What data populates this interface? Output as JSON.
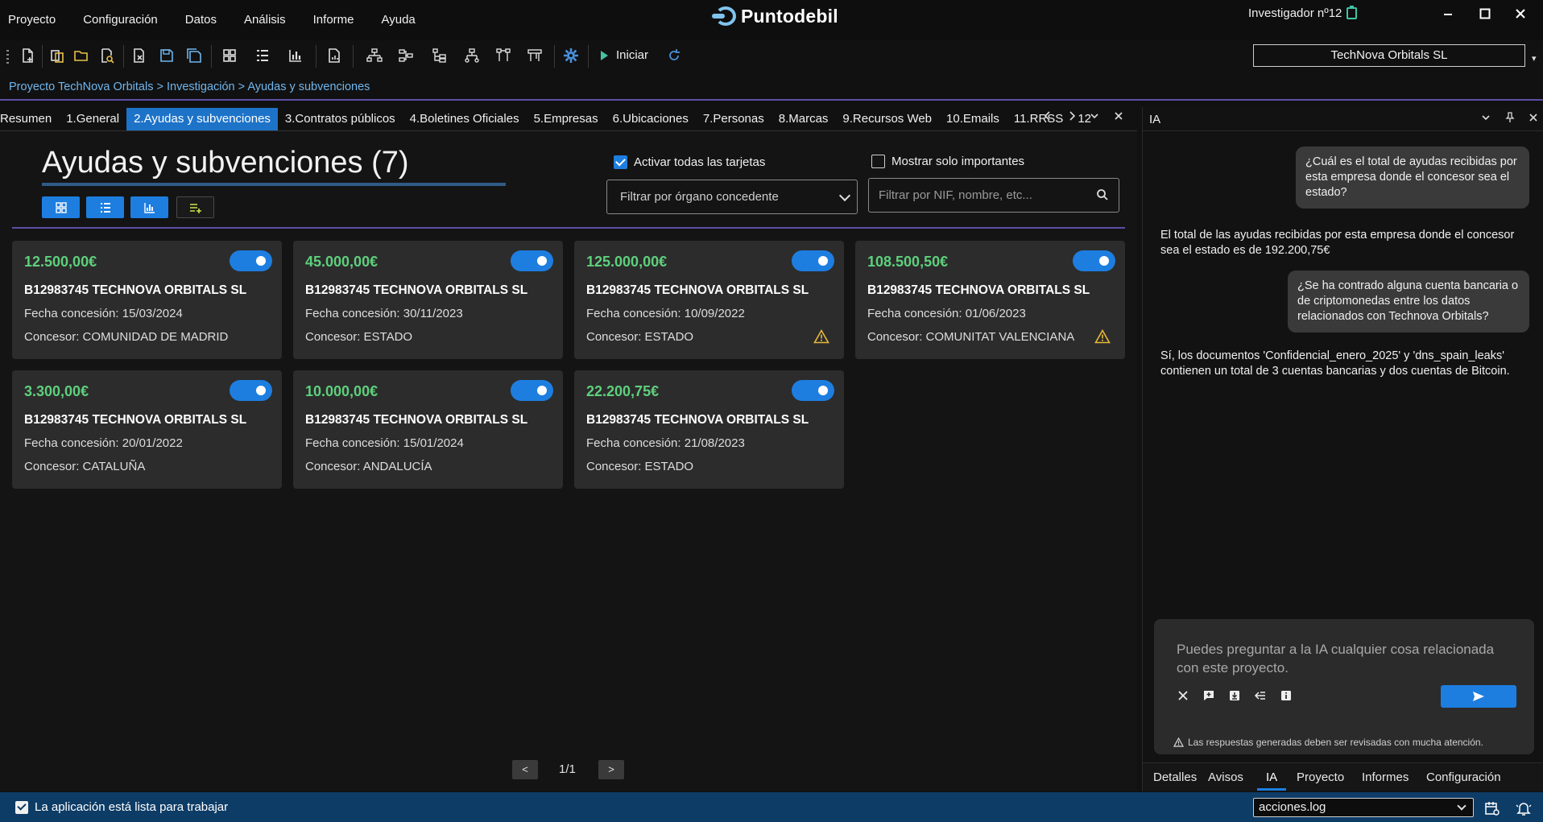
{
  "menu": {
    "items": [
      "Proyecto",
      "Configuración",
      "Datos",
      "Análisis",
      "Informe",
      "Ayuda"
    ]
  },
  "app": {
    "logo_text": "Puntodebil",
    "user": "Investigador nº12"
  },
  "toolbar": {
    "start_label": "Iniciar",
    "company": "TechNova Orbitals SL"
  },
  "breadcrumb": "Proyecto TechNova Orbitals > Investigación > Ayudas y subvenciones",
  "tabs": [
    "Resumen",
    "1.General",
    "2.Ayudas y subvenciones",
    "3.Contratos públicos",
    "4.Boletines Oficiales",
    "5.Empresas",
    "6.Ubicaciones",
    "7.Personas",
    "8.Marcas",
    "9.Recursos Web",
    "10.Emails",
    "11.RRSS",
    "12"
  ],
  "active_tab": "2.Ayudas y subvenciones",
  "main": {
    "title": "Ayudas y subvenciones (7)",
    "activate_all_label": "Activar todas las tarjetas",
    "activate_all_checked": true,
    "only_important_label": "Mostrar solo importantes",
    "only_important_checked": false,
    "filter_organ_placeholder": "Filtrar por órgano concedente",
    "filter_search_placeholder": "Filtrar por NIF, nombre, etc..."
  },
  "cards": [
    {
      "amount": "12.500,00€",
      "name": "B12983745 TECHNOVA ORBITALS SL",
      "date": "Fecha concesión: 15/03/2024",
      "org": "Concesor: COMUNIDAD DE MADRID",
      "warning": false,
      "enabled": true
    },
    {
      "amount": "45.000,00€",
      "name": "B12983745 TECHNOVA ORBITALS SL",
      "date": "Fecha concesión: 30/11/2023",
      "org": "Concesor: ESTADO",
      "warning": false,
      "enabled": true
    },
    {
      "amount": "125.000,00€",
      "name": "B12983745 TECHNOVA ORBITALS SL",
      "date": "Fecha concesión: 10/09/2022",
      "org": "Concesor: ESTADO",
      "warning": true,
      "enabled": true
    },
    {
      "amount": "108.500,50€",
      "name": "B12983745 TECHNOVA ORBITALS SL",
      "date": "Fecha concesión: 01/06/2023",
      "org": "Concesor: COMUNITAT VALENCIANA",
      "warning": true,
      "enabled": true
    },
    {
      "amount": "3.300,00€",
      "name": "B12983745 TECHNOVA ORBITALS SL",
      "date": "Fecha concesión: 20/01/2022",
      "org": "Concesor: CATALUÑA",
      "warning": false,
      "enabled": true
    },
    {
      "amount": "10.000,00€",
      "name": "B12983745 TECHNOVA ORBITALS SL",
      "date": "Fecha concesión: 15/01/2024",
      "org": "Concesor: ANDALUCÍA",
      "warning": false,
      "enabled": true
    },
    {
      "amount": "22.200,75€",
      "name": "B12983745 TECHNOVA ORBITALS SL",
      "date": "Fecha concesión: 21/08/2023",
      "org": "Concesor: ESTADO",
      "warning": false,
      "enabled": true
    }
  ],
  "pagination": {
    "prev": "<",
    "next": ">",
    "page_text": "1/1"
  },
  "ia": {
    "panel_title": "IA",
    "messages": [
      {
        "role": "user",
        "text": "¿Cuál es el total de ayudas recibidas por esta empresa donde el concesor sea el estado?"
      },
      {
        "role": "assistant",
        "text": "El total de las ayudas recibidas por esta empresa donde el concesor sea el estado es de 192.200,75€"
      },
      {
        "role": "user",
        "text": "¿Se ha contrado alguna cuenta bancaria o de criptomonedas entre los datos relacionados con Technova Orbitals?"
      },
      {
        "role": "assistant",
        "text": "Sí, los documentos 'Confidencial_enero_2025' y 'dns_spain_leaks' contienen un total de 3 cuentas bancarias y dos cuentas de Bitcoin."
      }
    ],
    "input_placeholder": "Puedes preguntar a la IA cualquier cosa relacionada con este proyecto.",
    "note": "Las respuestas generadas deben ser revisadas con mucha atención.",
    "bottom_tabs": [
      "Detalles",
      "Avisos",
      "IA",
      "Proyecto",
      "Informes",
      "Configuración"
    ],
    "active_bottom_tab": "IA"
  },
  "status": {
    "text": "La aplicación está lista para trabajar",
    "log_file": "acciones.log"
  },
  "colors": {
    "accent": "#1d7ee0",
    "amount_green": "#5ed07c",
    "status_bar": "#0d3c66",
    "divider_purple": "#5b4fa6",
    "warning": "#e8b83a"
  }
}
